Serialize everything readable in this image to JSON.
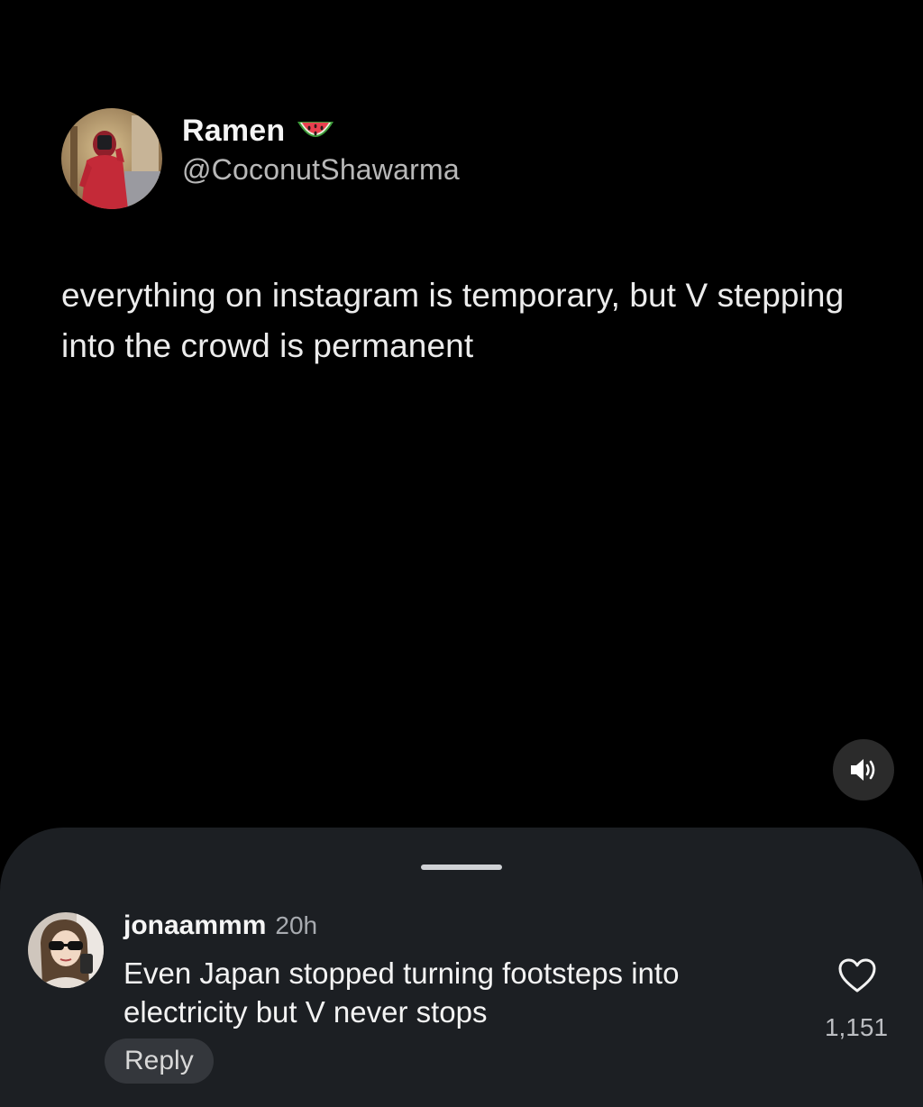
{
  "tweet": {
    "display_name": "Ramen",
    "name_emoji": "watermelon-icon",
    "handle": "@CoconutShawarma",
    "text": "everything on instagram is temporary, but V stepping into the crowd is permanent"
  },
  "media": {
    "sound_icon": "speaker-icon"
  },
  "comments": {
    "items": [
      {
        "username": "jonaammm",
        "time": "20h",
        "text": "Even Japan stopped turning footsteps into electricity but V never stops",
        "reply_label": "Reply",
        "like_count": "1,151",
        "like_icon": "heart-outline-icon"
      }
    ]
  },
  "colors": {
    "background": "#000000",
    "sheet": "#1c1f23",
    "reply_pill": "#34373c",
    "secondary_text": "#b8b8b8"
  }
}
